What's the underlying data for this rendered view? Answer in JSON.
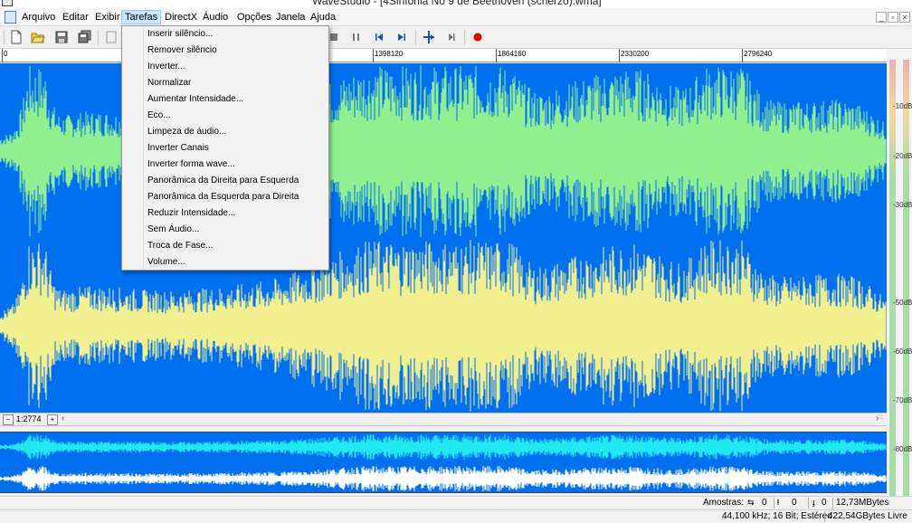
{
  "window": {
    "title": "WaveStudio - [4Sinfonia No 9 de Beethoven (scherzo).wma]"
  },
  "menubar": {
    "items": [
      "Arquivo",
      "Editar",
      "Exibir",
      "Tarefas",
      "DirectX",
      "Áudio",
      "Opções",
      "Janela",
      "Ajuda"
    ],
    "active": "Tarefas"
  },
  "dropdown": {
    "items": [
      "Inserir silêncio...",
      "Remover silêncio",
      "Inverter...",
      "Normalizar",
      "Aumentar Intensidade...",
      "Eco...",
      "Limpeza de áudio...",
      "Inverter Canais",
      "Inverter forma wave...",
      "Panorâmica da Direita para Esquerda",
      "Panorâmica da Esquerda para Direita",
      "Reduzir Intensidade...",
      "Sem Áudio...",
      "Troca de Fase...",
      "Volume..."
    ]
  },
  "ruler": {
    "labels": [
      "0",
      "1398120",
      "1864160",
      "2330200",
      "2796240"
    ]
  },
  "zoom": {
    "value": "1:2774"
  },
  "meter": {
    "labels": [
      "-10dB",
      "-20dB",
      "-30dB",
      "-50dB",
      "-60dB",
      "-70dB",
      "-80dB"
    ]
  },
  "status": {
    "samples_label": "Amostras:",
    "sel_length": "0",
    "sel_start": "0",
    "sel_end": "0",
    "file_size": "12,73MBytes",
    "format": "44,100 kHz; 16 Bit; Estéreo",
    "free_space": "422,54GBytes Livre"
  },
  "colors": {
    "wave_background": "#0070f0",
    "left_channel": "#90f090",
    "right_channel": "#f0f090",
    "overview_left": "#20e8f0",
    "overview_right": "#ffffff",
    "record": "#e00000"
  },
  "icons": [
    "new-file-icon",
    "open-folder-icon",
    "save-icon",
    "save-all-icon",
    "cut-icon",
    "pause-icon",
    "skip-start-icon",
    "skip-end-icon",
    "marker-icon",
    "step-icon",
    "record-icon"
  ]
}
